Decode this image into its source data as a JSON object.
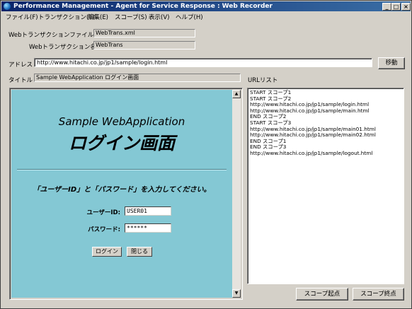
{
  "window": {
    "title": "Performance Management - Agent for Service Response : Web Recorder",
    "controls": {
      "minimize": "_",
      "maximize": "□",
      "close": "×"
    }
  },
  "menu": [
    "ファイル(F)",
    "トランザクション(T)",
    "編集(E)",
    "スコープ(S)",
    "表示(V)",
    "ヘルプ(H)"
  ],
  "form": {
    "file_label": "Webトランザクションファイル名",
    "file_value": "WebTrans.xml",
    "trans_label": "Webトランザクション名",
    "trans_value": "WebTrans",
    "address_label": "アドレス",
    "address_value": "http://www.hitachi.co.jp/jp1/sample/login.html",
    "go_button": "移動",
    "title_label": "タイトル",
    "title_value": "Sample WebApplication ログイン画面",
    "urllist_label": "URLリスト"
  },
  "browser_page": {
    "heading1": "Sample WebApplication",
    "heading2": "ログイン画面",
    "instruction": "「ユーザーID」と「パスワード」を入力してください。",
    "userid_label": "ユーザーID:",
    "userid_value": "USER01",
    "password_label": "パスワード:",
    "password_value": "******",
    "login_button": "ログイン",
    "close_button": "閉じる"
  },
  "url_list": [
    "START スコープ1",
    "START スコープ2",
    "http://www.hitachi.co.jp/jp1/sample/login.html",
    "http://www.hitachi.co.jp/jp1/sample/main.html",
    "END スコープ2",
    "START スコープ3",
    "http://www.hitachi.co.jp/jp1/sample/main01.html",
    "http://www.hitachi.co.jp/jp1/sample/main02.html",
    "END スコープ1",
    "END スコープ3",
    "http://www.hitachi.co.jp/jp1/sample/logout.html"
  ],
  "bottom_buttons": {
    "scope_start": "スコープ起点",
    "scope_end": "スコープ終点"
  },
  "colors": {
    "titlebar": "#0a246a",
    "page_background": "#84c8d4",
    "window_face": "#d4d0c8"
  }
}
